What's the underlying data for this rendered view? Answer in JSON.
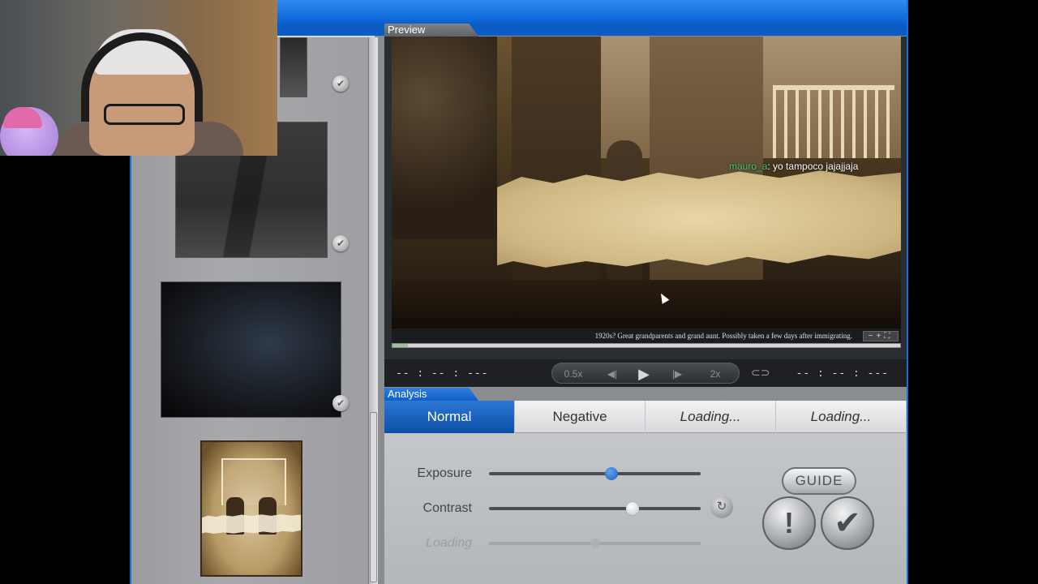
{
  "preview": {
    "tab_label": "Preview",
    "caption": "1920s? Great grandparents and grand aunt. Possibly taken a few days after immigrating.",
    "zoom_controls": "−+⛶",
    "chat": {
      "user": "mauro_a",
      "message": "yo tampoco jajajjaja"
    },
    "progress": 0.03
  },
  "transport": {
    "time_left": "-- : -- : ---",
    "time_right": "-- : -- : ---",
    "speed_slow": "0.5x",
    "speed_fast": "2x",
    "prev": "◀|",
    "play": "▶",
    "next": "|▶",
    "loop": "⊂⊃"
  },
  "analysis": {
    "tab_label": "Analysis",
    "tabs": [
      "Normal",
      "Negative",
      "Loading...",
      "Loading..."
    ],
    "active_tab": 0,
    "sliders": [
      {
        "label": "Exposure",
        "value": 0.58
      },
      {
        "label": "Contrast",
        "value": 0.68
      },
      {
        "label": "Loading",
        "value": 0.5
      }
    ],
    "guide_label": "GUIDE",
    "report_label": "!",
    "confirm_label": "✔",
    "reset_icon": "↻"
  },
  "thumbnails": {
    "check_icon": "✔"
  },
  "colors": {
    "accent": "#0d4ea6",
    "title_bar": "#1a6fd6",
    "chat_user": "#3ed07a"
  }
}
